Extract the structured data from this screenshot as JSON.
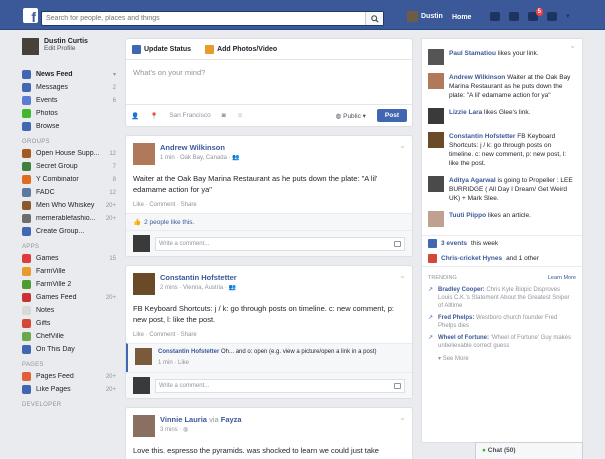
{
  "topbar": {
    "search_placeholder": "Search for people, places and things",
    "user_name": "Dustin",
    "home_label": "Home",
    "notification_count": "5"
  },
  "sidebar": {
    "profile": {
      "name": "Dustin Curtis",
      "edit_label": "Edit Profile"
    },
    "main_items": [
      {
        "label": "News Feed",
        "count": "",
        "color": "#4267b2"
      },
      {
        "label": "Messages",
        "count": "2",
        "color": "#4267b2"
      },
      {
        "label": "Events",
        "count": "6",
        "color": "#4267b2"
      },
      {
        "label": "Photos",
        "count": "",
        "color": "#42b72a"
      },
      {
        "label": "Browse",
        "count": "",
        "color": "#4267b2"
      }
    ],
    "groups_title": "GROUPS",
    "groups": [
      {
        "label": "Open House Supp...",
        "count": "12",
        "color": "#a45a1f"
      },
      {
        "label": "Secret Group",
        "count": "7",
        "color": "#3f7f3f"
      },
      {
        "label": "Y Combinator",
        "count": "8",
        "color": "#e06c1f"
      },
      {
        "label": "FADC",
        "count": "12",
        "color": "#5b7a9d"
      },
      {
        "label": "Men Who Whiskey",
        "count": "20+",
        "color": "#8a5a2b"
      },
      {
        "label": "memerablefashio...",
        "count": "20+",
        "color": "#6d6d6d"
      },
      {
        "label": "Create Group...",
        "count": "",
        "color": "#4267b2"
      }
    ],
    "apps_title": "APPS",
    "apps": [
      {
        "label": "Games",
        "count": "15",
        "color": "#e03a3e"
      },
      {
        "label": "FarmVille",
        "count": "",
        "color": "#e89a2b"
      },
      {
        "label": "FarmVille 2",
        "count": "",
        "color": "#4c9c2e"
      },
      {
        "label": "Games Feed",
        "count": "20+",
        "color": "#c93333"
      },
      {
        "label": "Notes",
        "count": "",
        "color": "#d9d9d9"
      },
      {
        "label": "Gifts",
        "count": "",
        "color": "#d24a37"
      },
      {
        "label": "ChefVille",
        "count": "",
        "color": "#6aa84f"
      },
      {
        "label": "On This Day",
        "count": "",
        "color": "#4267b2"
      }
    ],
    "pages_title": "PAGES",
    "pages": [
      {
        "label": "Pages Feed",
        "count": "20+",
        "color": "#e0603a"
      },
      {
        "label": "Like Pages",
        "count": "20+",
        "color": "#4267b2"
      }
    ],
    "developer_title": "DEVELOPER"
  },
  "composer": {
    "tab_status": "Update Status",
    "tab_photo": "Add Photos/Video",
    "placeholder": "What's on your mind?",
    "location": "San Francisco",
    "audience": "Public",
    "post_label": "Post"
  },
  "posts": [
    {
      "author": "Andrew Wilkinson",
      "meta": "1 min · Oak Bay, Canada ·",
      "text": "Waiter at the Oak Bay Marina Restaurant as he puts down the plate: \"A lil' edamame action for ya\"",
      "actions": "Like · Comment · Share",
      "likes": "2 people like this.",
      "comment_placeholder": "Write a comment..."
    },
    {
      "author": "Constantin Hofstetter",
      "meta": "2 mins · Vienna, Austria ·",
      "text": "FB Keyboard Shortcuts: j / k: go through posts on timeline. c: new comment, p: new post, l: like the post.",
      "actions": "Like · Comment · Share",
      "comment_author": "Constantin Hofstetter",
      "comment_text": "Oh... and o: open (e.g. view a picture/open a link in a post)",
      "comment_meta": "1 min · Like",
      "comment_placeholder": "Write a comment..."
    },
    {
      "author": "Vinnie Lauria",
      "via": "via",
      "via_name": "Fayza",
      "meta": "3 mins ·",
      "text": "Love this. espresso the pyramids. was shocked to learn we could just take"
    }
  ],
  "ticker": [
    {
      "name": "Paul Stamatiou",
      "text": "likes your link."
    },
    {
      "name": "Andrew Wilkinson",
      "text": "Waiter at the Oak Bay Marina Restaurant as he puts down the plate: \"A lil' edamame action for ya\""
    },
    {
      "name": "Lizzie Lara",
      "text": "likes Glee's link."
    },
    {
      "name": "Constantin Hofstetter",
      "text": "FB Keyboard Shortcuts: j / k: go through posts on timeline. c: new comment, p: new post, l: like the post."
    },
    {
      "name": "Aditya Agarwal",
      "text": "is going to Propeller : LEE BURRIDGE ( All Day I Dream/ Get Weird UK) + Mark Slee."
    },
    {
      "name": "Tuuti Piippo",
      "text": "likes an article."
    }
  ],
  "events": {
    "count_text": "3 events",
    "suffix": "this week",
    "birthdays": "Chris-cricket Hynes",
    "birthdays_suffix": "and 1 other"
  },
  "trending": {
    "title": "TRENDING",
    "learn_more": "Learn More",
    "items": [
      {
        "name": "Bradley Cooper:",
        "text": "Chris Kyle Biopic Disproves Louis C.K.'s Statement About the Greatest Sniper of Alltime"
      },
      {
        "name": "Fred Phelps:",
        "text": "Westboro church founder Fred Phelps dies"
      },
      {
        "name": "Wheel of Fortune:",
        "text": "'Wheel of Fortune' Guy makes unbelievable correct guess"
      }
    ],
    "see_more": "See More"
  },
  "chat": {
    "label": "Chat (50)"
  }
}
